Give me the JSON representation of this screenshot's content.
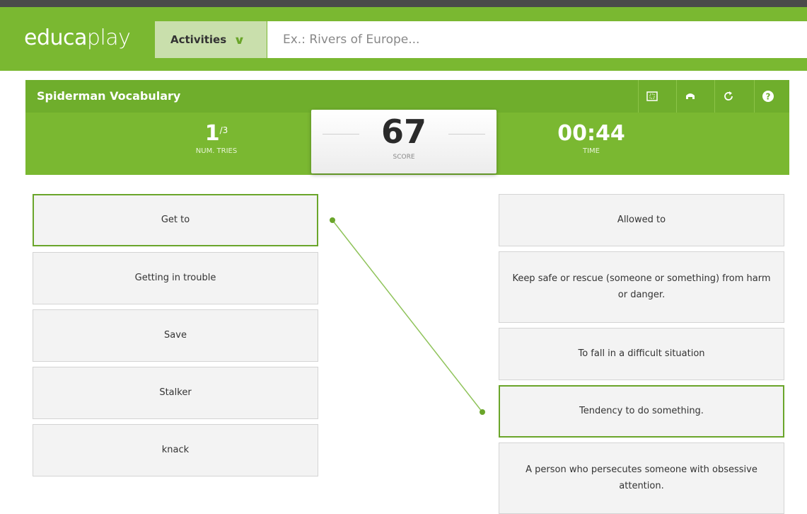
{
  "header": {
    "logo_main": "educa",
    "logo_light": "play",
    "activities_label": "Activities",
    "search_placeholder": "Ex.: Rivers of Europe..."
  },
  "game": {
    "title": "Spiderman Vocabulary",
    "toolbar_icons": [
      "fullscreen-icon",
      "print-icon",
      "restart-icon",
      "help-icon"
    ],
    "tries": "1",
    "tries_total": "/3",
    "tries_label": "NUM. TRIES",
    "score": "67",
    "score_label": "SCORE",
    "time": "00:44",
    "time_label": "TIME"
  },
  "left_items": [
    "Get to",
    "Getting in trouble",
    "Save",
    "Stalker",
    "knack"
  ],
  "right_items": [
    "Allowed to",
    "Keep safe or rescue (someone or something) from harm or danger.",
    "To fall in a difficult situation",
    "Tendency to do something.",
    "A person who persecutes someone with obsessive attention."
  ],
  "colors": {
    "accent": "#7ab831",
    "selected_border": "#6aa52a"
  }
}
